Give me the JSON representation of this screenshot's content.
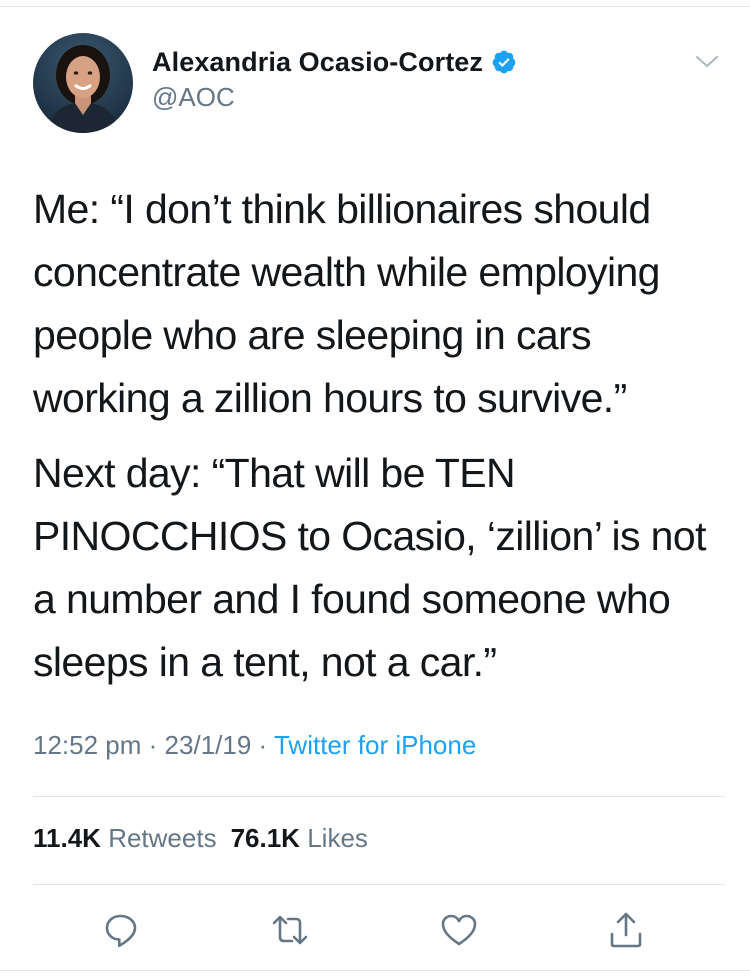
{
  "author": {
    "display_name": "Alexandria Ocasio-Cortez",
    "handle": "@AOC",
    "verified": true
  },
  "tweet": {
    "paragraphs": [
      "Me: “I don’t think billionaires should concentrate wealth while employing people who are sleeping in cars working a zillion hours to survive.”",
      "Next day: “That will be TEN PINOCCHIOS to Ocasio, ‘zillion’ is not a number and I found someone who sleeps in a tent, not a car.”"
    ]
  },
  "meta": {
    "time": "12:52 pm",
    "date": "23/1/19",
    "separator": "·",
    "source": "Twitter for iPhone"
  },
  "stats": {
    "retweets_count": "11.4K",
    "retweets_label": "Retweets",
    "likes_count": "76.1K",
    "likes_label": "Likes"
  },
  "colors": {
    "text": "#14171a",
    "secondary": "#657786",
    "link": "#1da1f2",
    "divider": "#e1e8ed"
  },
  "icons": {
    "verified": "verified-badge-icon",
    "caret": "chevron-down-icon",
    "reply": "reply-icon",
    "retweet": "retweet-icon",
    "like": "heart-icon",
    "share": "share-icon"
  }
}
